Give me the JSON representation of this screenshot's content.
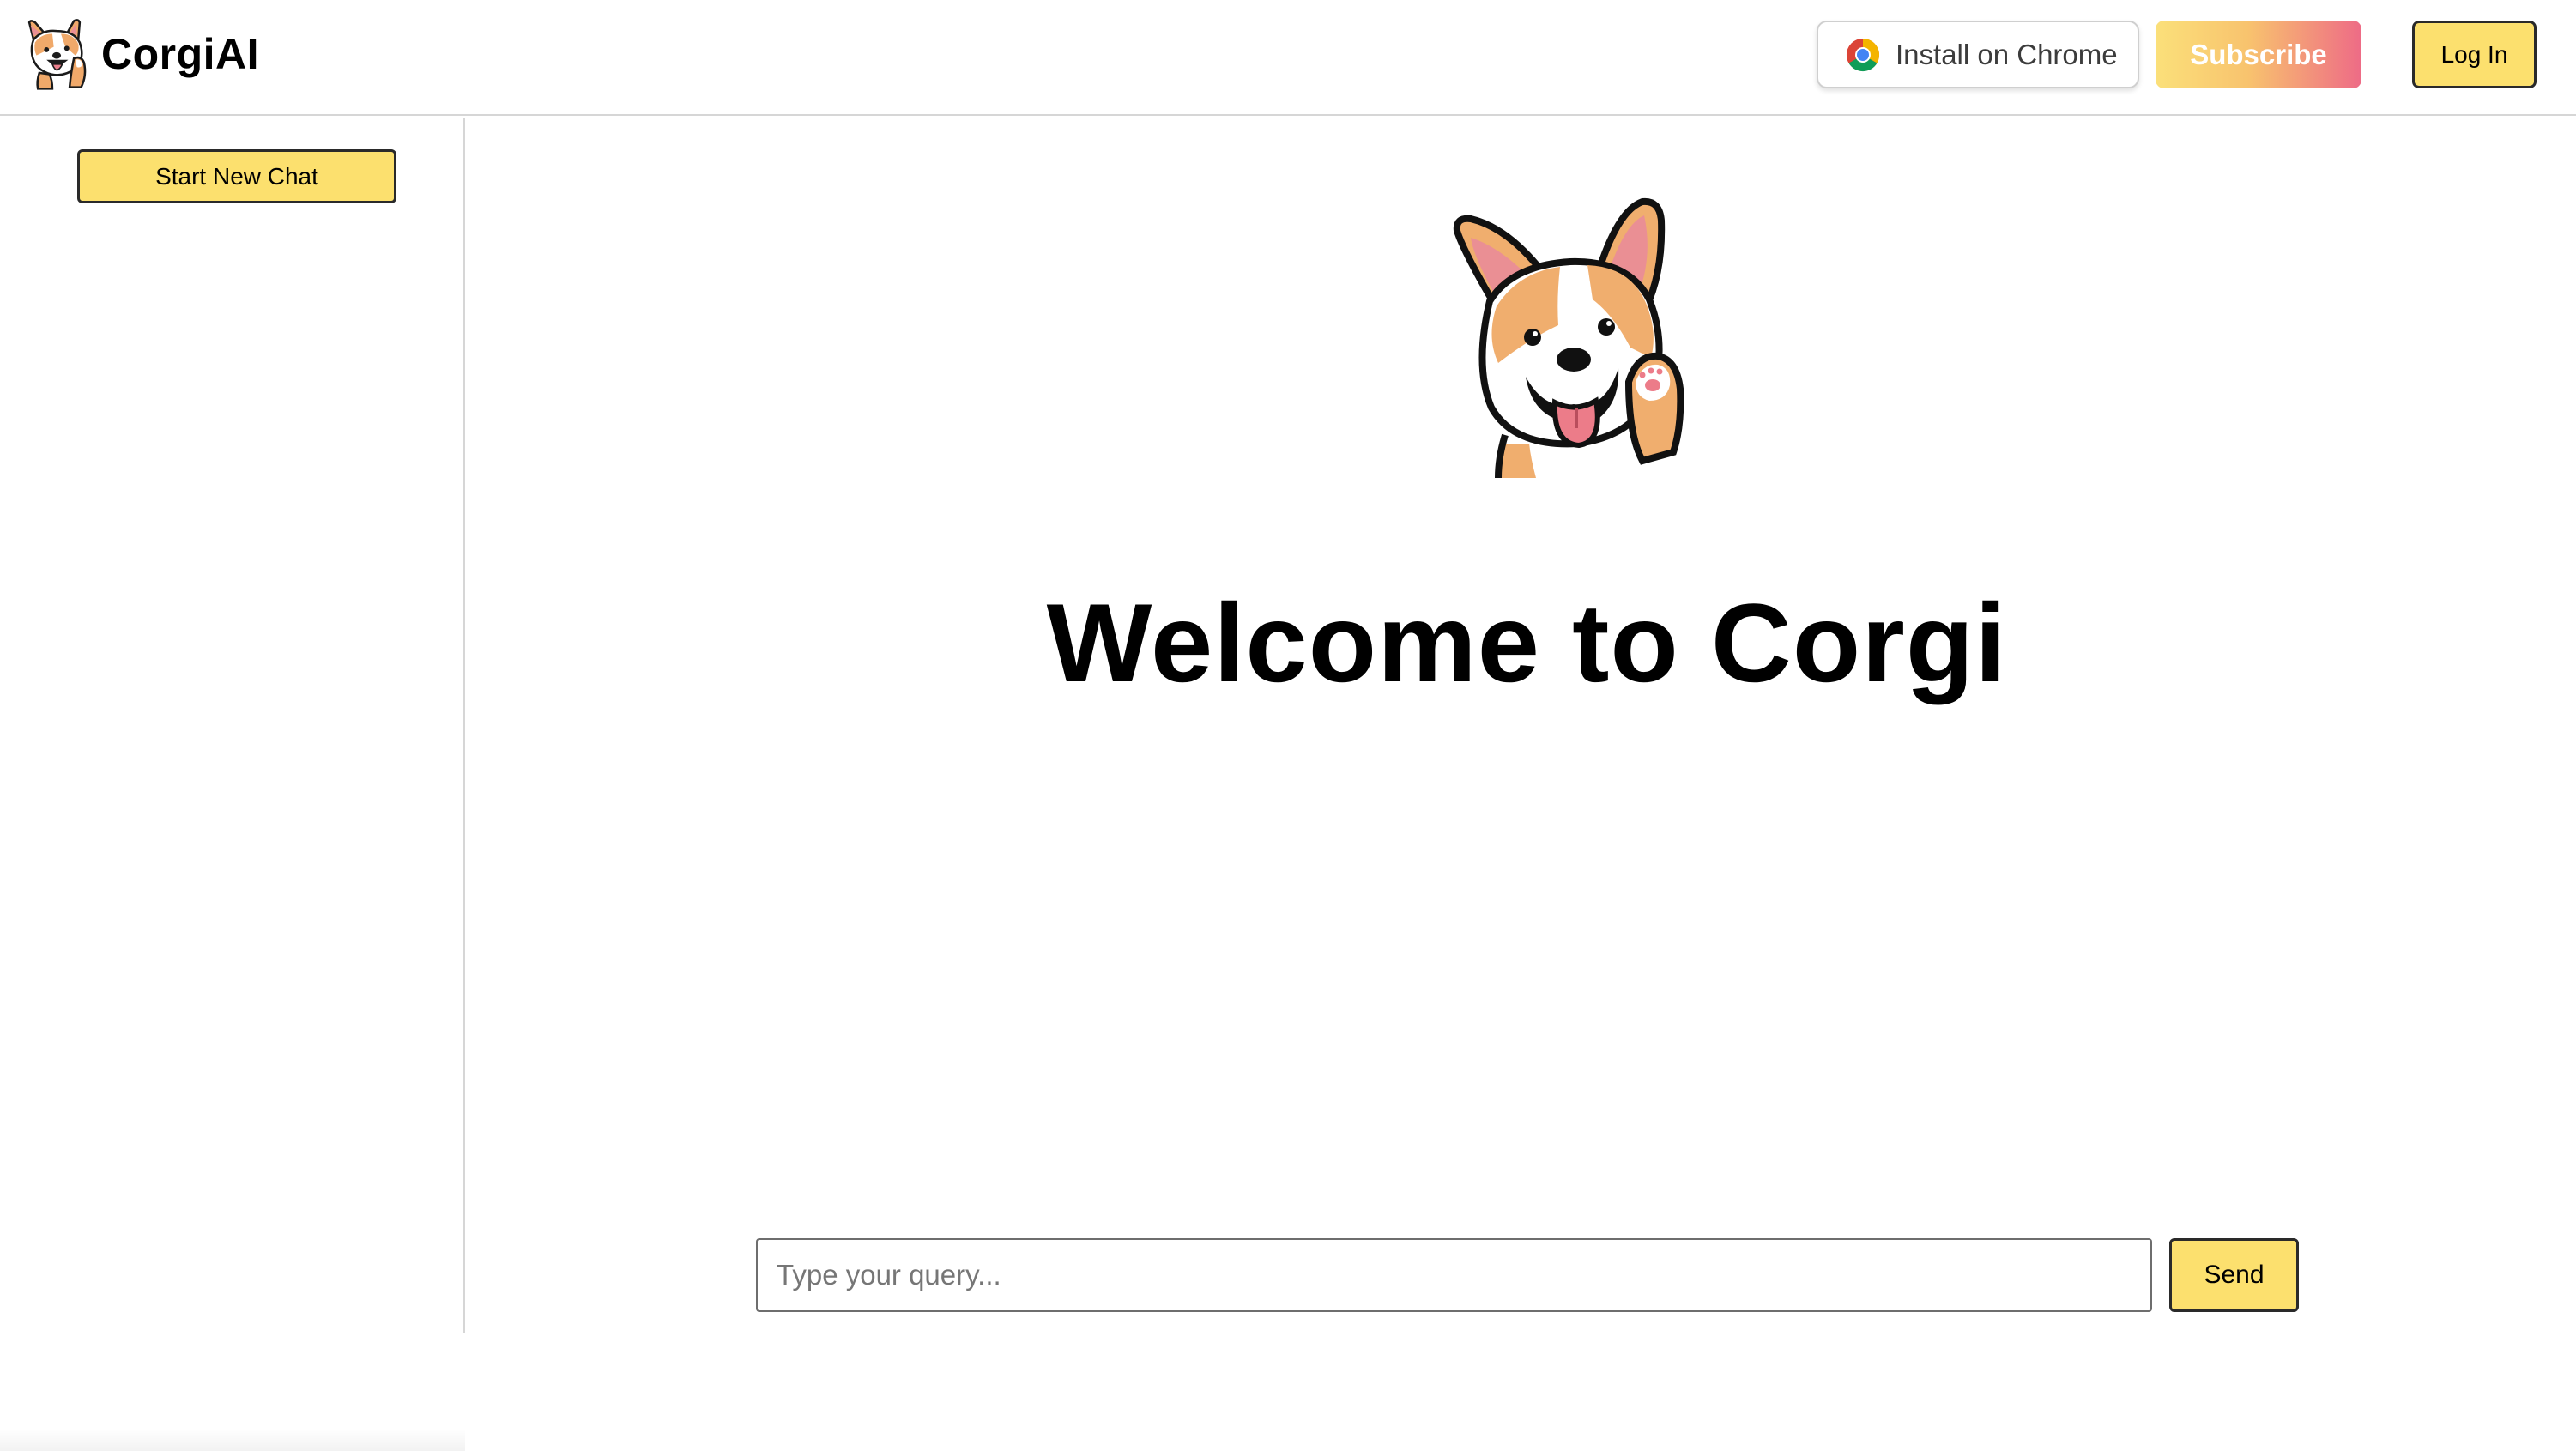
{
  "header": {
    "brand_name": "CorgiAI",
    "brand_logo_icon": "corgi-logo-icon",
    "install_label": "Install on Chrome",
    "install_icon": "chrome-icon",
    "subscribe_label": "Subscribe",
    "login_label": "Log In"
  },
  "sidebar": {
    "new_chat_label": "Start New Chat"
  },
  "main": {
    "hero_icon": "corgi-waving-icon",
    "welcome_title": "Welcome to Corgi"
  },
  "composer": {
    "placeholder": "Type your query...",
    "value": "",
    "send_label": "Send"
  },
  "colors": {
    "accent_yellow": "#fce06e",
    "subscribe_gradient_start": "#fbe07a",
    "subscribe_gradient_end": "#ee6b86",
    "border": "#d6d6d6"
  }
}
